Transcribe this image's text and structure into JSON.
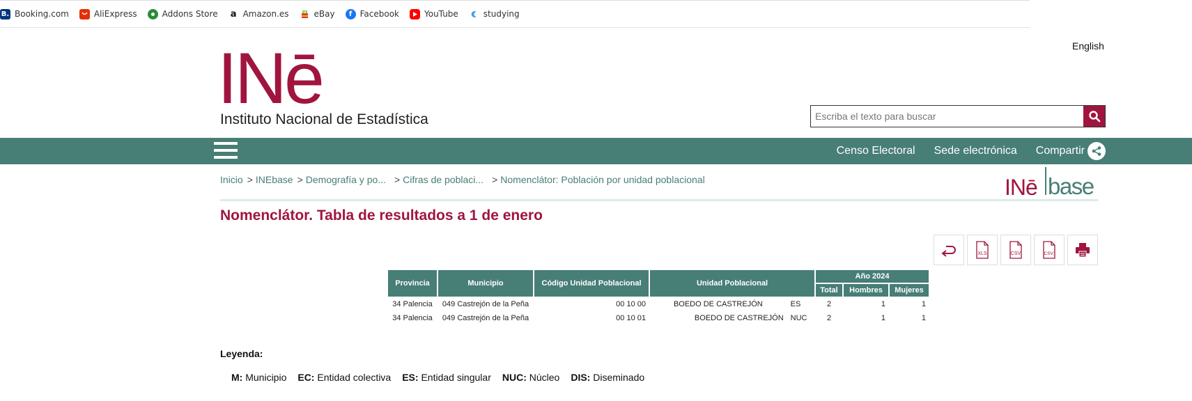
{
  "bookmarks": [
    {
      "label": "Booking.com",
      "icon": "booking-icon",
      "glyph": "B."
    },
    {
      "label": "AliExpress",
      "icon": "aliexpress-icon",
      "glyph": ""
    },
    {
      "label": "Addons Store",
      "icon": "addons-icon",
      "glyph": ""
    },
    {
      "label": "Amazon.es",
      "icon": "amazon-icon",
      "glyph": "a"
    },
    {
      "label": "eBay",
      "icon": "ebay-icon",
      "glyph": ""
    },
    {
      "label": "Facebook",
      "icon": "facebook-icon",
      "glyph": "f"
    },
    {
      "label": "YouTube",
      "icon": "youtube-icon",
      "glyph": ""
    },
    {
      "label": "studying",
      "icon": "studying-icon",
      "glyph": ""
    }
  ],
  "header": {
    "language": "English",
    "logo_letters": "INē",
    "logo_subtitle": "Instituto Nacional de Estadística",
    "search_placeholder": "Escriba el texto para buscar"
  },
  "nav": {
    "links": [
      "Censo Electoral",
      "Sede electrónica",
      "Compartir"
    ]
  },
  "breadcrumb": [
    "Inicio",
    "INEbase",
    "Demografía y po...",
    "Cifras de poblaci...",
    "Nomenclátor: Población por unidad poblacional"
  ],
  "inebase_logo": {
    "left": "INē",
    "right": "base"
  },
  "page_title": "Nomenclátor. Tabla de resultados a 1 de enero",
  "table": {
    "headers": {
      "provincia": "Provincia",
      "municipio": "Municipio",
      "codigo": "Código Unidad Poblacional",
      "unidad": "Unidad Poblacional",
      "year": "Año 2024",
      "total": "Total",
      "hombres": "Hombres",
      "mujeres": "Mujeres"
    },
    "rows": [
      {
        "provincia": "34 Palencia",
        "municipio": "049 Castrejón de la Peña",
        "codigo": "00 10 00",
        "unidad": "BOEDO DE CASTREJÓN",
        "tipo": "ES",
        "total": "2",
        "hombres": "1",
        "mujeres": "1"
      },
      {
        "provincia": "34 Palencia",
        "municipio": "049 Castrejón de la Peña",
        "codigo": "00 10 01",
        "unidad": "BOEDO DE CASTREJÓN",
        "tipo": "NUC",
        "total": "2",
        "hombres": "1",
        "mujeres": "1"
      }
    ]
  },
  "legend": {
    "title": "Leyenda:",
    "items": [
      {
        "code": "M:",
        "desc": "Municipio"
      },
      {
        "code": "EC:",
        "desc": "Entidad colectiva"
      },
      {
        "code": "ES:",
        "desc": "Entidad singular"
      },
      {
        "code": "NUC:",
        "desc": "Núcleo"
      },
      {
        "code": "DIS:",
        "desc": "Diseminado"
      }
    ]
  },
  "colors": {
    "brand": "#a0153e",
    "nav": "#477e76",
    "cell": "#dcebe8"
  }
}
